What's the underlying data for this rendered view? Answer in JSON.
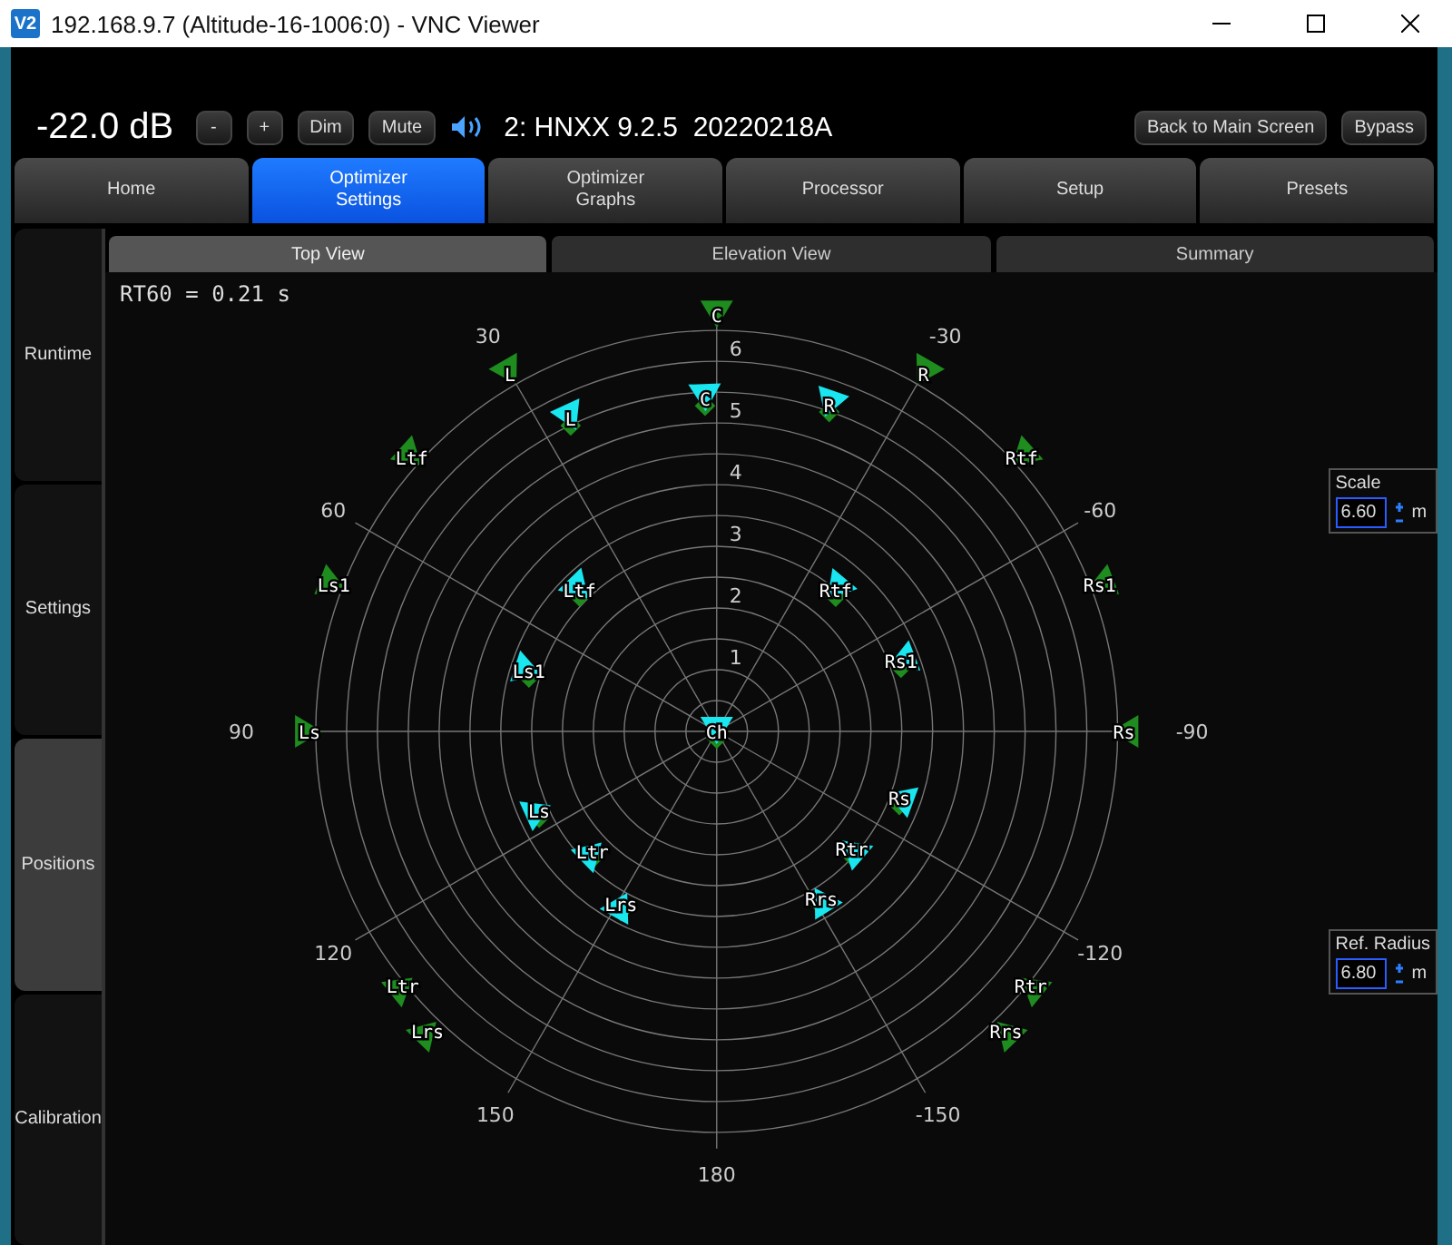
{
  "window": {
    "title": "192.168.9.7 (Altitude-16-1006:0) - VNC Viewer",
    "app_badge": "V2"
  },
  "top_bar": {
    "volume": "-22.0 dB",
    "buttons": [
      {
        "label": "-"
      },
      {
        "label": "+"
      },
      {
        "label": "Dim"
      },
      {
        "label": "Mute"
      }
    ],
    "preset_info": "2: HNXX 9.2.5  20220218A",
    "right_buttons": [
      {
        "label": "Back to Main Screen"
      },
      {
        "label": "Bypass"
      }
    ]
  },
  "main_tabs": [
    {
      "label": "Home",
      "selected": false
    },
    {
      "label": "Optimizer\nSettings",
      "selected": true
    },
    {
      "label": "Optimizer\nGraphs",
      "selected": false
    },
    {
      "label": "Processor",
      "selected": false
    },
    {
      "label": "Setup",
      "selected": false
    },
    {
      "label": "Presets",
      "selected": false
    }
  ],
  "side_tabs": [
    {
      "label": "Runtime",
      "selected": false
    },
    {
      "label": "Settings",
      "selected": false
    },
    {
      "label": "Positions",
      "selected": true
    },
    {
      "label": "Calibration",
      "selected": false
    }
  ],
  "sub_tabs": [
    {
      "label": "Top View",
      "selected": true
    },
    {
      "label": "Elevation View",
      "selected": false
    },
    {
      "label": "Summary",
      "selected": false
    }
  ],
  "plot": {
    "rt60": "RT60 = 0.21 s",
    "ring_labels": [
      "6",
      "5",
      "4",
      "3",
      "2",
      "1"
    ],
    "angle_labels": [
      "30",
      "60",
      "90",
      "120",
      "150",
      "180",
      "-150",
      "-120",
      "-90",
      "-60",
      "-30"
    ],
    "speakers": [
      {
        "label": "C",
        "kind": "reference"
      },
      {
        "label": "L",
        "kind": "reference"
      },
      {
        "label": "R",
        "kind": "reference"
      },
      {
        "label": "Ltf",
        "kind": "reference"
      },
      {
        "label": "Rtf",
        "kind": "reference"
      },
      {
        "label": "Ls1",
        "kind": "reference"
      },
      {
        "label": "Rs1",
        "kind": "reference"
      },
      {
        "label": "Ls",
        "kind": "reference"
      },
      {
        "label": "Rs",
        "kind": "reference"
      },
      {
        "label": "Ltr",
        "kind": "reference"
      },
      {
        "label": "Lrs",
        "kind": "reference"
      },
      {
        "label": "Rtr",
        "kind": "reference"
      },
      {
        "label": "Rrs",
        "kind": "reference"
      },
      {
        "label": "C",
        "kind": "measured"
      },
      {
        "label": "L",
        "kind": "measured"
      },
      {
        "label": "R",
        "kind": "measured"
      },
      {
        "label": "Ltf",
        "kind": "measured"
      },
      {
        "label": "Rtf",
        "kind": "measured"
      },
      {
        "label": "Ls1",
        "kind": "measured"
      },
      {
        "label": "Rs1",
        "kind": "measured"
      },
      {
        "label": "Ch",
        "kind": "measured"
      },
      {
        "label": "Ls",
        "kind": "measured"
      },
      {
        "label": "Ltr",
        "kind": "measured"
      },
      {
        "label": "Lrs",
        "kind": "measured"
      },
      {
        "label": "Rs",
        "kind": "measured"
      },
      {
        "label": "Rtr",
        "kind": "measured"
      },
      {
        "label": "Rrs",
        "kind": "measured"
      }
    ]
  },
  "scale": {
    "label": "Scale",
    "value": "6.60",
    "unit": "m"
  },
  "ref_radius": {
    "label": "Ref. Radius",
    "value": "6.80",
    "unit": "m"
  }
}
